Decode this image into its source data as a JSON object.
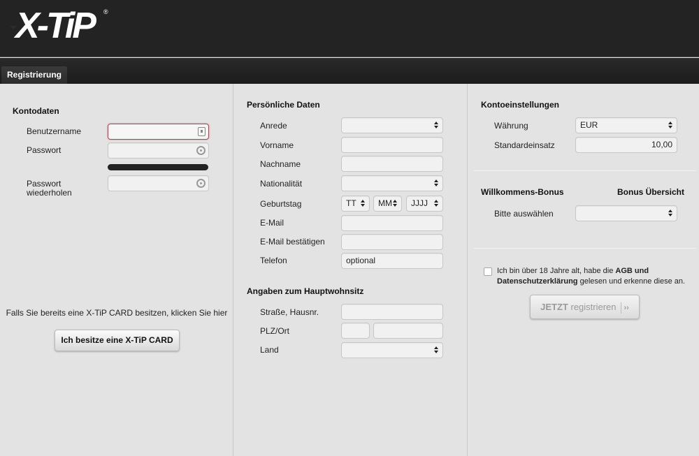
{
  "header": {
    "logo": "X-TiP",
    "logo_reg": "®"
  },
  "tabs": [
    {
      "label": "Registrierung"
    }
  ],
  "account": {
    "title": "Kontodaten",
    "username_label": "Benutzername",
    "password_label": "Passwort",
    "password_repeat_label": "Passwort wiederholen",
    "card_hint": "Falls Sie bereits eine X-TiP CARD besitzen, klicken Sie hier",
    "card_button": "Ich besitze eine X-TiP CARD"
  },
  "personal": {
    "title": "Persönliche Daten",
    "salutation_label": "Anrede",
    "firstname_label": "Vorname",
    "lastname_label": "Nachname",
    "nationality_label": "Nationalität",
    "birthday_label": "Geburtstag",
    "birthday_day": "TT",
    "birthday_month": "MM",
    "birthday_year": "JJJJ",
    "email_label": "E-Mail",
    "email_confirm_label": "E-Mail bestätigen",
    "phone_label": "Telefon",
    "phone_placeholder": "optional"
  },
  "residence": {
    "title": "Angaben zum Hauptwohnsitz",
    "street_label": "Straße, Hausnr.",
    "zip_city_label": "PLZ/Ort",
    "country_label": "Land"
  },
  "settings": {
    "title": "Kontoeinstellungen",
    "currency_label": "Währung",
    "currency_value": "EUR",
    "stake_label": "Standardeinsatz",
    "stake_value": "10,00"
  },
  "bonus": {
    "title": "Willkommens-Bonus",
    "overview_link": "Bonus Übersicht",
    "select_label": "Bitte auswählen"
  },
  "terms": {
    "text_1": "Ich bin über 18 Jahre alt, habe die ",
    "agb": "AGB und",
    "privacy": "Datenschutzerklärung",
    "text_2": " gelesen und erkenne diese an."
  },
  "submit": {
    "bold": "JETZT",
    "rest": " registrieren",
    "arrows": "››"
  }
}
